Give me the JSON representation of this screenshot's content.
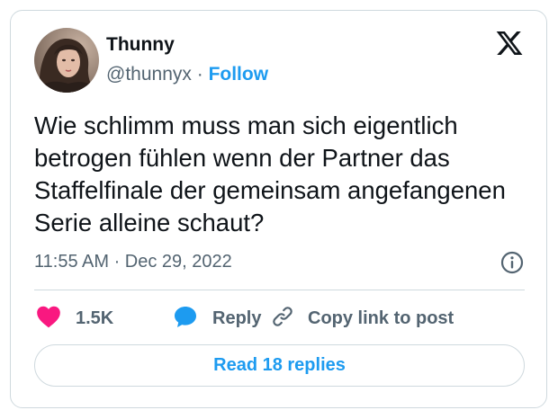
{
  "author": {
    "name": "Thunny",
    "handle": "@thunnyx",
    "separator": "·",
    "follow_label": "Follow"
  },
  "tweet": {
    "text": "Wie schlimm muss man sich eigentlich betrogen fühlen wenn der Partner das Staffelfinale der gemeinsam angefangenen Serie alleine schaut?",
    "timestamp": "11:55 AM · Dec 29, 2022"
  },
  "actions": {
    "like_count": "1.5K",
    "reply_label": "Reply",
    "copy_label": "Copy link to post"
  },
  "read_replies_label": "Read 18 replies",
  "colors": {
    "accent": "#1d9bf0",
    "like": "#f91880",
    "muted": "#536471",
    "border": "#cfd9de"
  },
  "icons": [
    "avatar-photo",
    "x-logo-icon",
    "info-icon",
    "heart-icon",
    "reply-bubble-icon",
    "link-icon"
  ]
}
